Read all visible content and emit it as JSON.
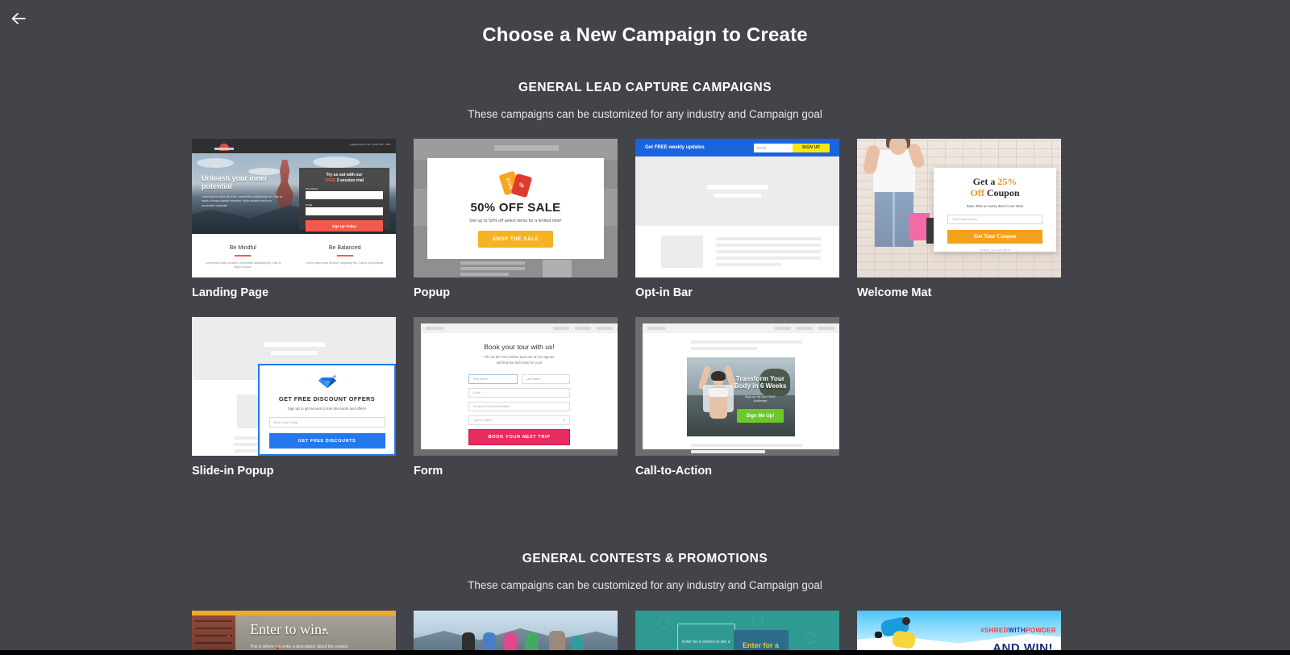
{
  "header": {
    "back_icon": "arrow-left-icon",
    "title": "Choose a New Campaign to Create"
  },
  "sections": [
    {
      "id": "general-lead-capture",
      "title": "GENERAL LEAD CAPTURE CAMPAIGNS",
      "subtitle": "These campaigns can be customized for any industry and Campaign goal"
    },
    {
      "id": "general-contests",
      "title": "GENERAL CONTESTS & PROMOTIONS",
      "subtitle": "These campaigns can be customized for any industry and Campaign goal"
    }
  ],
  "cards": {
    "landing_page": {
      "label": "Landing Page",
      "nav_contact": "yoga@moment.com | (408) 555 - 1234",
      "headline": "Unleash your inner potential",
      "body": "Lorem ipsum dolor sit amet, consectetur adipiscing elit. Cras id turpis in turpis blandit interdum. Nulla sodales tortor eu accumsan vulputate.",
      "form_title_1": "Try us out with our",
      "form_title_free": "FREE",
      "form_title_2": " 3 session trial",
      "field_first_name": "First Name",
      "field_email": "Email",
      "cta": "Sign Up Today!",
      "col1_title": "Be Mindful",
      "col1_body": "Lorem ipsum dolor sit amet, consectetur adipiscing elit. Cras id turpis in turpis.",
      "col2_title": "Be Balanced",
      "col2_body": "Lorem ipsum dolor sit amet, adipiscing elit. Cras id turpis blandit."
    },
    "popup": {
      "label": "Popup",
      "tag_a_text": "SALE",
      "tag_b_text": "%",
      "headline": "50% OFF SALE",
      "sub": "Get up to 50% off select items for a limited time!",
      "cta": "SHOP THE SALE"
    },
    "optin_bar": {
      "label": "Opt-in Bar",
      "bar_text": "Get FREE weekly updates",
      "email_placeholder": "Email",
      "cta": "SIGN UP"
    },
    "welcome_mat": {
      "label": "Welcome Mat",
      "headline_1": "Get a ",
      "headline_pct": "25%",
      "headline_off": "Off",
      "headline_2": " Coupon",
      "sub": "Save 25% on every item in our store",
      "email_placeholder": "Your Email Address",
      "cta": "Get Your Coupon",
      "fine_print": "No thanks, I don't want 25% off"
    },
    "slide_in_popup": {
      "label": "Slide-in Popup",
      "icon": "diamond-icon",
      "headline": "GET FREE DISCOUNT OFFERS",
      "sub": "Sign up to get access to free discounts and offers!",
      "email_placeholder": "Enter Your Email",
      "cta": "GET FREE DISCOUNTS"
    },
    "form": {
      "label": "Form",
      "headline": "Book your tour with us!",
      "sub_line1": "Fill out the form below and one of our agents",
      "sub_line2": "will find the best deal for you!",
      "field_first_name": "First Name",
      "field_last_name": "Last Name",
      "field_email": "Email",
      "field_destination": "Preferred Travel Destination",
      "field_type": "Type of Travel",
      "cta": "BOOK YOUR NEXT TRIP"
    },
    "call_to_action": {
      "label": "Call-to-Action",
      "headline_line1": "Transform Your",
      "headline_line2": "Body in 6 Weeks",
      "sub_line1": "Sign up for our FREE",
      "sub_line2": "challenge",
      "cta": "Sign Me Up!"
    }
  },
  "contest_cards": [
    {
      "id": "enter-to-win",
      "headline": "Enter to win..",
      "sub": "This is where you enter a description about the contest"
    },
    {
      "id": "yoga-retreat",
      "headline": "",
      "sub": ""
    },
    {
      "id": "tech-giveaway",
      "headline": "Enter for a chance to win a",
      "badge": "Enter for a"
    },
    {
      "id": "shred-with-powder",
      "hashtag_a": "#SHRED",
      "hashtag_b": "WITH",
      "hashtag_c": "POWDER",
      "headline": "AND WIN!"
    }
  ],
  "colors": {
    "background": "#424449",
    "text": "#ffffff",
    "accent_blue": "#2378ee",
    "accent_yellow": "#fbe70e",
    "accent_pink": "#ea2b5d",
    "accent_green": "#6cc82b",
    "accent_orange": "#f5a01d",
    "accent_red": "#f25a4c"
  }
}
